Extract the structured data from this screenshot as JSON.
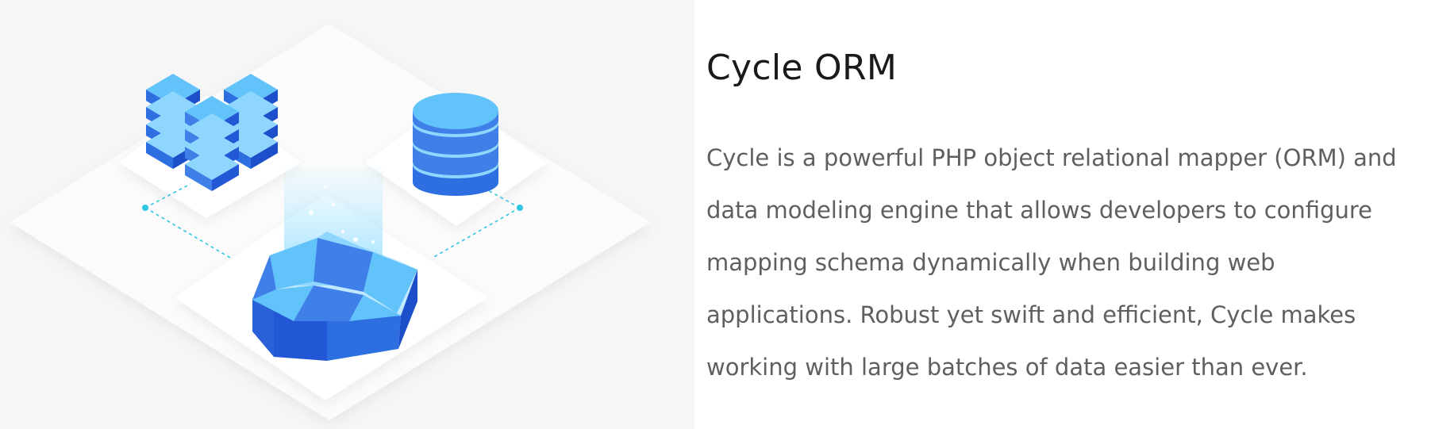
{
  "main": {
    "title": "Cycle ORM",
    "description": "Cycle is a powerful PHP object relational mapper (ORM) and data modeling engine that allows developers to configure mapping schema dynamically when building web applications. Robust yet swift and efficient, Cycle makes working with large batches of data easier than ever."
  },
  "illustration": {
    "icons": [
      "server-stack-icon",
      "database-cylinder-icon",
      "orm-octagon-ring-icon"
    ],
    "colors": {
      "panel_background": "#f6f6f6",
      "primary_blue": "#3f7fe8",
      "light_blue": "#62c3fb",
      "deep_blue": "#1c4fc9",
      "connector_cyan": "#2ec6e0"
    }
  }
}
